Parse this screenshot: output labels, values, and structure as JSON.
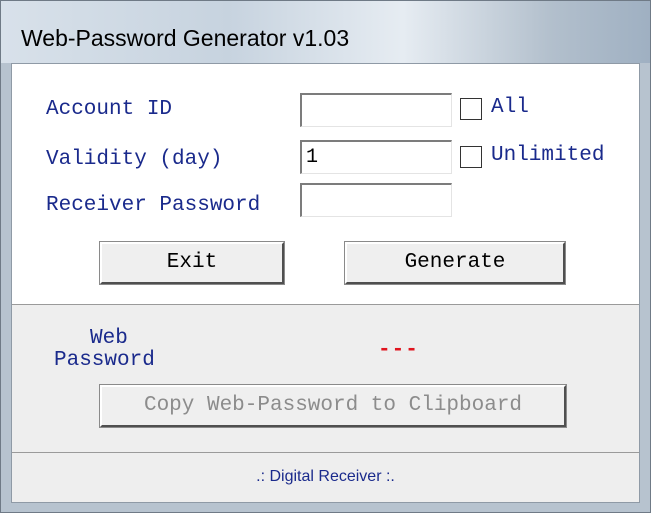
{
  "window": {
    "title": "Web-Password Generator v1.03"
  },
  "form": {
    "account_id_label": "Account ID",
    "account_id_value": "",
    "all_label": "All",
    "validity_label": "Validity (day)",
    "validity_value": "1",
    "unlimited_label": "Unlimited",
    "receiver_password_label": "Receiver Password",
    "receiver_password_value": ""
  },
  "buttons": {
    "exit_label": "Exit",
    "generate_label": "Generate",
    "copy_label": "Copy Web-Password to Clipboard"
  },
  "result": {
    "label_line1": "Web",
    "label_line2": "Password",
    "value": "---"
  },
  "footer": {
    "text": ".: Digital Receiver :."
  }
}
